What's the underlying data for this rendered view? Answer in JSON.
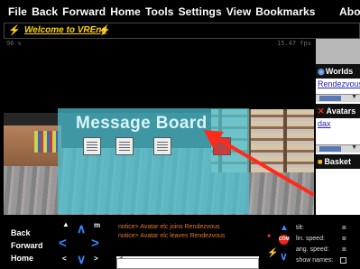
{
  "menubar": {
    "items": [
      "File",
      "Back",
      "Forward",
      "Home",
      "Tools",
      "Settings",
      "View",
      "Bookmarks"
    ],
    "about": "Abo"
  },
  "titlebar": {
    "welcome": "Welcome to VREng"
  },
  "view3d": {
    "counter": "96 s",
    "fps": "15.47 fps",
    "board_title": "Message Board"
  },
  "panels": {
    "worlds": {
      "title": "Worlds",
      "link": "Rendezvous"
    },
    "avatars": {
      "title": "Avatars",
      "link": "dax"
    },
    "basket": {
      "title": "Basket"
    }
  },
  "navigation": {
    "back": "Back",
    "forward": "Forward",
    "home": "Home",
    "m_key": "m"
  },
  "console": {
    "lines": [
      "notice> Avatar elc joins Rendezvous",
      "notice> Avatar elc leaves Rendezvous"
    ],
    "input_value": ""
  },
  "status": {
    "tilt_label": "tilt:",
    "tilt_value": "=",
    "lin_speed_label": "lin. speed:",
    "lin_speed_value": "=",
    "ang_speed_label": "ang. speed:",
    "ang_speed_value": "=",
    "show_names_label": "show names:",
    "show_names_checked": false
  },
  "colors": {
    "accent_yellow": "#ffd700",
    "nav_blue": "#3a86ff",
    "board_cyan": "#48c4d4",
    "console_orange": "#e07a2a",
    "arrow_red": "#ff2a1a"
  }
}
